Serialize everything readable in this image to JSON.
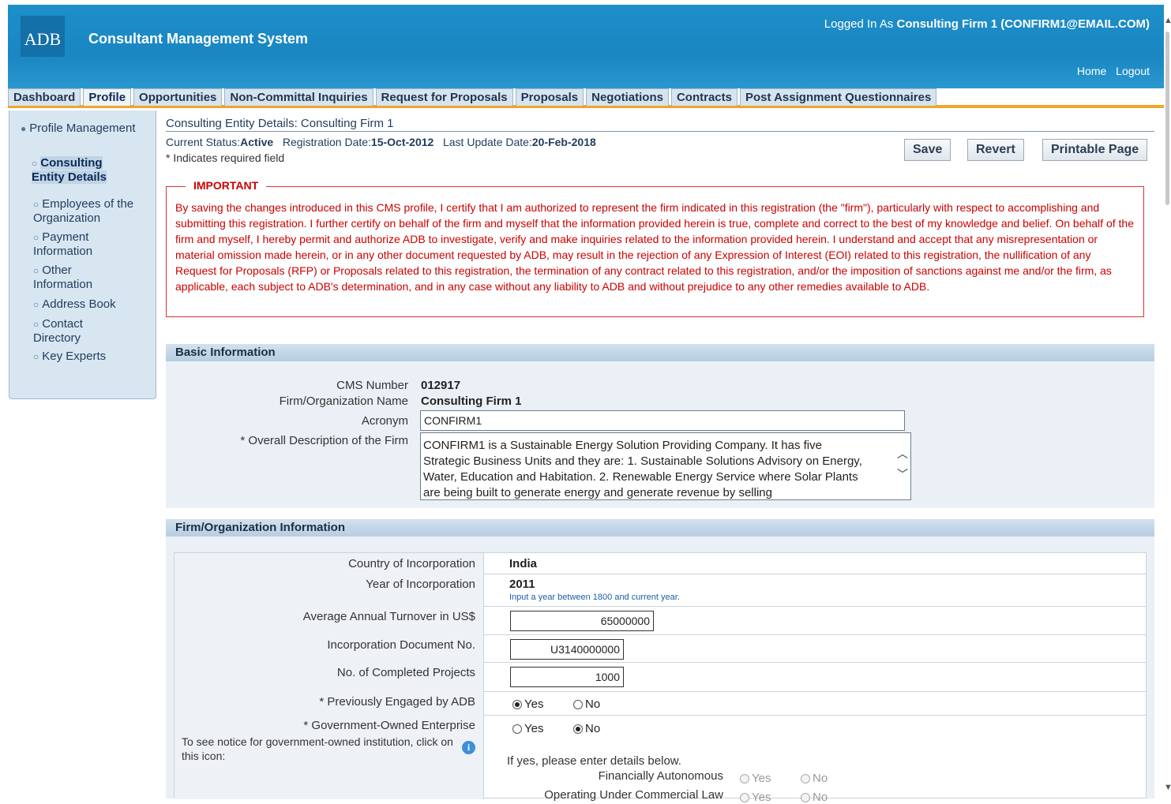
{
  "header": {
    "logo": "ADB",
    "app_title": "Consultant Management System",
    "logged_in_prefix": "Logged In As",
    "logged_in_user": "Consulting Firm 1 (CONFIRM1@EMAIL.COM)",
    "links": {
      "home": "Home",
      "logout": "Logout"
    }
  },
  "tabs": [
    "Dashboard",
    "Profile",
    "Opportunities",
    "Non-Committal Inquiries",
    "Request for Proposals",
    "Proposals",
    "Negotiations",
    "Contracts",
    "Post Assignment Questionnaires"
  ],
  "active_tab": "Profile",
  "sidebar": {
    "root": "Profile Management",
    "items": [
      {
        "label": "Consulting Entity Details",
        "active": true
      },
      {
        "label": "Employees of the Organization",
        "active": false
      },
      {
        "label": "Payment Information",
        "active": false
      },
      {
        "label": "Other Information",
        "active": false
      },
      {
        "label": "Address Book",
        "active": false
      },
      {
        "label": "Contact Directory",
        "active": false
      },
      {
        "label": "Key Experts",
        "active": false
      }
    ]
  },
  "page": {
    "heading": "Consulting Entity Details: Consulting Firm 1",
    "status_label": "Current Status:",
    "status_value": "Active",
    "reg_label": "Registration Date:",
    "reg_value": "15-Oct-2012",
    "update_label": "Last Update Date:",
    "update_value": "20-Feb-2018",
    "required_note": "* Indicates required field",
    "buttons": {
      "save": "Save",
      "revert": "Revert",
      "printable": "Printable Page"
    }
  },
  "important": {
    "title": "IMPORTANT",
    "text": "By saving the changes introduced in this CMS profile, I certify that I am authorized to represent the firm indicated in this registration (the \"firm\"), particularly with respect to accomplishing and submitting this registration. I further certify on behalf of the firm and myself that the information provided herein is true, complete and correct to the best of my knowledge and belief. On behalf of the firm and myself, I hereby permit and authorize ADB to investigate, verify and make inquiries related to the information provided herein. I understand and accept that any misrepresentation or material omission made herein, or in any other document requested by ADB, may result in the rejection of any Expression of Interest (EOI) related to this registration, the nullification of any Request for Proposals (RFP) or Proposals related to this registration, the termination of any contract related to this registration, and/or the imposition of sanctions against me and/or the firm, as applicable, each subject to ADB's determination, and in any case without any liability to ADB and without prejudice to any other remedies available to ADB."
  },
  "basic": {
    "title": "Basic Information",
    "cms_label": "CMS Number",
    "cms_value": "012917",
    "name_label": "Firm/Organization Name",
    "name_value": "Consulting Firm 1",
    "acronym_label": "Acronym",
    "acronym_value": "CONFIRM1",
    "desc_label": "* Overall Description of the Firm",
    "desc_value": "CONFIRM1  is a Sustainable Energy Solution Providing Company. It has five Strategic Business Units and they are: 1. Sustainable Solutions Advisory on Energy, Water, Education and Habitation. 2. Renewable Energy Service where Solar Plants are being built to generate energy and generate revenue by selling"
  },
  "firm": {
    "title": "Firm/Organization Information",
    "country_label": "Country of Incorporation",
    "country_value": "India",
    "year_label": "Year of Incorporation",
    "year_value": "2011",
    "year_hint": "Input a year between 1800 and current year.",
    "turnover_label": "Average Annual Turnover in US$",
    "turnover_value": "65000000",
    "docno_label": "Incorporation Document No.",
    "docno_value": "U3140000000",
    "projects_label": "No. of Completed Projects",
    "projects_value": "1000",
    "engaged_label": "* Previously Engaged by ADB",
    "gov_label": "* Government-Owned Enterprise",
    "gov_notice": "To see notice for government-owned institution, click on this icon:",
    "gov_details": "If yes, please enter details below.",
    "fin_label": "Financially Autonomous",
    "law_label": "Operating Under Commercial Law",
    "yes": "Yes",
    "no": "No"
  }
}
